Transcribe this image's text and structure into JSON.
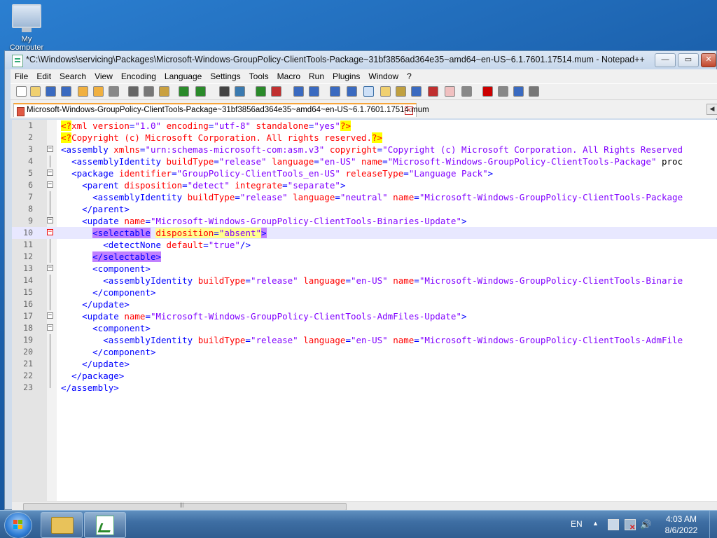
{
  "desktop": {
    "icon_label": "My Computer"
  },
  "window": {
    "title": "*C:\\Windows\\servicing\\Packages\\Microsoft-Windows-GroupPolicy-ClientTools-Package~31bf3856ad364e35~amd64~en-US~6.1.7601.17514.mum - Notepad++",
    "buttons": {
      "minimize": "—",
      "maximize": "▭",
      "close": "✕"
    }
  },
  "menu": [
    "File",
    "Edit",
    "Search",
    "View",
    "Encoding",
    "Language",
    "Settings",
    "Tools",
    "Macro",
    "Run",
    "Plugins",
    "Window",
    "?"
  ],
  "toolbar": {
    "icons": [
      "new-file",
      "open-file",
      "save",
      "save-all",
      "close",
      "close-all",
      "print",
      "cut",
      "copy",
      "paste",
      "undo",
      "redo",
      "find",
      "replace",
      "zoom-in",
      "zoom-out",
      "sync-vertical",
      "sync-horizontal",
      "word-wrap",
      "show-all-chars",
      "indent-guide",
      "define-language",
      "document-map",
      "function-list",
      "folder-as-workspace",
      "monitoring",
      "macro-record",
      "macro-stop",
      "macro-play",
      "macro-run-multiple",
      "save-macro"
    ]
  },
  "tab": {
    "label": "Microsoft-Windows-GroupPolicy-ClientTools-Package~31bf3856ad364e35~amd64~en-US~6.1.7601.17514.mum"
  },
  "editor": {
    "current_line": 10,
    "lines": [
      "<?xml version=\"1.0\" encoding=\"utf-8\" standalone=\"yes\"?>",
      "<?Copyright (c) Microsoft Corporation. All rights reserved.?>",
      "<assembly xmlns=\"urn:schemas-microsoft-com:asm.v3\" copyright=\"Copyright (c) Microsoft Corporation. All Rights Reserved",
      "  <assemblyIdentity buildType=\"release\" language=\"en-US\" name=\"Microsoft-Windows-GroupPolicy-ClientTools-Package\" proc",
      "  <package identifier=\"GroupPolicy-ClientTools_en-US\" releaseType=\"Language Pack\">",
      "    <parent disposition=\"detect\" integrate=\"separate\">",
      "      <assemblyIdentity buildType=\"release\" language=\"neutral\" name=\"Microsoft-Windows-GroupPolicy-ClientTools-Package",
      "    </parent>",
      "    <update name=\"Microsoft-Windows-GroupPolicy-ClientTools-Binaries-Update\">",
      "      <selectable disposition=\"absent\">",
      "        <detectNone default=\"true\"/>",
      "      </selectable>",
      "      <component>",
      "        <assemblyIdentity buildType=\"release\" language=\"en-US\" name=\"Microsoft-Windows-GroupPolicy-ClientTools-Binarie",
      "      </component>",
      "    </update>",
      "    <update name=\"Microsoft-Windows-GroupPolicy-ClientTools-AdmFiles-Update\">",
      "      <component>",
      "        <assemblyIdentity buildType=\"release\" language=\"en-US\" name=\"Microsoft-Windows-GroupPolicy-ClientTools-AdmFile",
      "      </component>",
      "    </update>",
      "  </package>",
      "</assembly>"
    ],
    "fold_markers": [
      "",
      "",
      "-",
      "",
      "-",
      "-",
      "",
      "",
      "-",
      "-",
      "",
      "",
      "-",
      "",
      "",
      "",
      "-",
      "-",
      "",
      "",
      "",
      "",
      ""
    ]
  },
  "taskbar": {
    "language": "EN",
    "time": "4:03 AM",
    "date": "8/6/2022"
  },
  "colors": {
    "tag": "#0000ff",
    "attribute": "#ff0000",
    "value": "#8000ff",
    "current_line": "#e8e8ff",
    "tab_accent": "#f6a43a"
  }
}
